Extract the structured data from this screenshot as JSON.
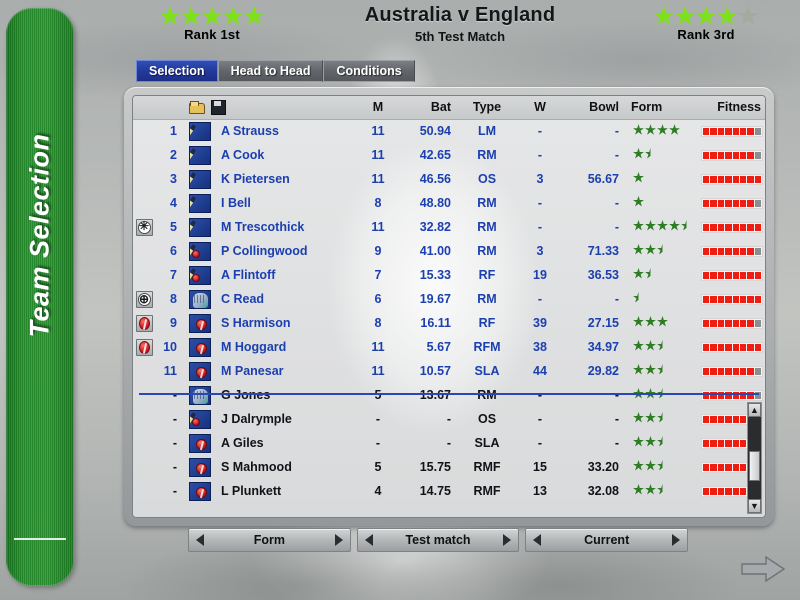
{
  "sidebar": {
    "label": "Team Selection"
  },
  "header": {
    "title": "Australia v England",
    "subtitle": "5th Test Match",
    "home": {
      "rank_text": "Rank 1st",
      "stars": 5,
      "empty_stars": 0
    },
    "away": {
      "rank_text": "Rank 3rd",
      "stars": 4,
      "empty_stars": 1
    }
  },
  "tabs": [
    {
      "label": "Selection",
      "active": true
    },
    {
      "label": "Head to Head",
      "active": false
    },
    {
      "label": "Conditions",
      "active": false
    }
  ],
  "toolbar": {
    "open_icon": "open-folder-icon",
    "save_icon": "floppy-disk-icon"
  },
  "table": {
    "columns": [
      "M",
      "Bat",
      "Type",
      "W",
      "Bowl",
      "Form",
      "Fitness"
    ],
    "xi": [
      {
        "flag": "none",
        "num": "1",
        "icon": "batsman",
        "name": "A Strauss",
        "m": "11",
        "bat": "50.94",
        "type": "LM",
        "w": "-",
        "bowl": "-",
        "form": 4,
        "fitness": 7
      },
      {
        "flag": "none",
        "num": "2",
        "icon": "batsman",
        "name": "A Cook",
        "m": "11",
        "bat": "42.65",
        "type": "RM",
        "w": "-",
        "bowl": "-",
        "form": 1.5,
        "fitness": 7
      },
      {
        "flag": "none",
        "num": "3",
        "icon": "batsman",
        "name": "K Pietersen",
        "m": "11",
        "bat": "46.56",
        "type": "OS",
        "w": "3",
        "bowl": "56.67",
        "form": 1,
        "fitness": 8
      },
      {
        "flag": "none",
        "num": "4",
        "icon": "batsman",
        "name": "I Bell",
        "m": "8",
        "bat": "48.80",
        "type": "RM",
        "w": "-",
        "bowl": "-",
        "form": 1,
        "fitness": 7
      },
      {
        "flag": "captain",
        "num": "5",
        "icon": "batsman",
        "name": "M Trescothick",
        "m": "11",
        "bat": "32.82",
        "type": "RM",
        "w": "-",
        "bowl": "-",
        "form": 4.5,
        "fitness": 8
      },
      {
        "flag": "none",
        "num": "6",
        "icon": "allrounder",
        "name": "P Collingwood",
        "m": "9",
        "bat": "41.00",
        "type": "RM",
        "w": "3",
        "bowl": "71.33",
        "form": 2.5,
        "fitness": 7
      },
      {
        "flag": "none",
        "num": "7",
        "icon": "allrounder",
        "name": "A Flintoff",
        "m": "7",
        "bat": "15.33",
        "type": "RF",
        "w": "19",
        "bowl": "36.53",
        "form": 1.5,
        "fitness": 8
      },
      {
        "flag": "keeper",
        "num": "8",
        "icon": "keeper",
        "name": "C Read",
        "m": "6",
        "bat": "19.67",
        "type": "RM",
        "w": "-",
        "bowl": "-",
        "form": 0.5,
        "fitness": 8
      },
      {
        "flag": "newball",
        "num": "9",
        "icon": "bowler",
        "name": "S Harmison",
        "m": "8",
        "bat": "16.11",
        "type": "RF",
        "w": "39",
        "bowl": "27.15",
        "form": 3,
        "fitness": 7
      },
      {
        "flag": "newball",
        "num": "10",
        "icon": "bowler",
        "name": "M Hoggard",
        "m": "11",
        "bat": "5.67",
        "type": "RFM",
        "w": "38",
        "bowl": "34.97",
        "form": 2.5,
        "fitness": 8
      },
      {
        "flag": "none",
        "num": "11",
        "icon": "bowler",
        "name": "M Panesar",
        "m": "11",
        "bat": "10.57",
        "type": "SLA",
        "w": "44",
        "bowl": "29.82",
        "form": 2.5,
        "fitness": 7
      }
    ],
    "reserves": [
      {
        "flag": "none",
        "num": "-",
        "icon": "keeper",
        "name": "G Jones",
        "m": "5",
        "bat": "13.67",
        "type": "RM",
        "w": "-",
        "bowl": "-",
        "form": 2.5,
        "fitness": 7
      },
      {
        "flag": "none",
        "num": "-",
        "icon": "allrounder",
        "name": "J Dalrymple",
        "m": "-",
        "bat": "-",
        "type": "OS",
        "w": "-",
        "bowl": "-",
        "form": 2.5,
        "fitness": 7
      },
      {
        "flag": "none",
        "num": "-",
        "icon": "bowler",
        "name": "A Giles",
        "m": "-",
        "bat": "-",
        "type": "SLA",
        "w": "-",
        "bowl": "-",
        "form": 2.5,
        "fitness": 7
      },
      {
        "flag": "none",
        "num": "-",
        "icon": "bowler",
        "name": "S Mahmood",
        "m": "5",
        "bat": "15.75",
        "type": "RMF",
        "w": "15",
        "bowl": "33.20",
        "form": 2.5,
        "fitness": 7
      },
      {
        "flag": "none",
        "num": "-",
        "icon": "bowler",
        "name": "L Plunkett",
        "m": "4",
        "bat": "14.75",
        "type": "RMF",
        "w": "13",
        "bowl": "32.08",
        "form": 2.5,
        "fitness": 7
      }
    ]
  },
  "selectors": [
    {
      "label": "Form"
    },
    {
      "label": "Test match"
    },
    {
      "label": "Current"
    }
  ],
  "scrollbar": {
    "up": "▲",
    "down": "▼"
  },
  "next_button": {
    "icon": "right-arrow-icon"
  },
  "colors": {
    "sidebar_green": "#2a9a31",
    "rank_star": "#7ee01a",
    "active_tab_blue": "#23399c",
    "player_text_blue": "#1c3fb0",
    "form_star_green": "#2e7d24",
    "fitness_red": "#f01d12",
    "fitness_empty": "#8b8d8f",
    "divider_blue": "#2a46b8"
  },
  "fitness_segments": 8,
  "form_max_stars": 5
}
